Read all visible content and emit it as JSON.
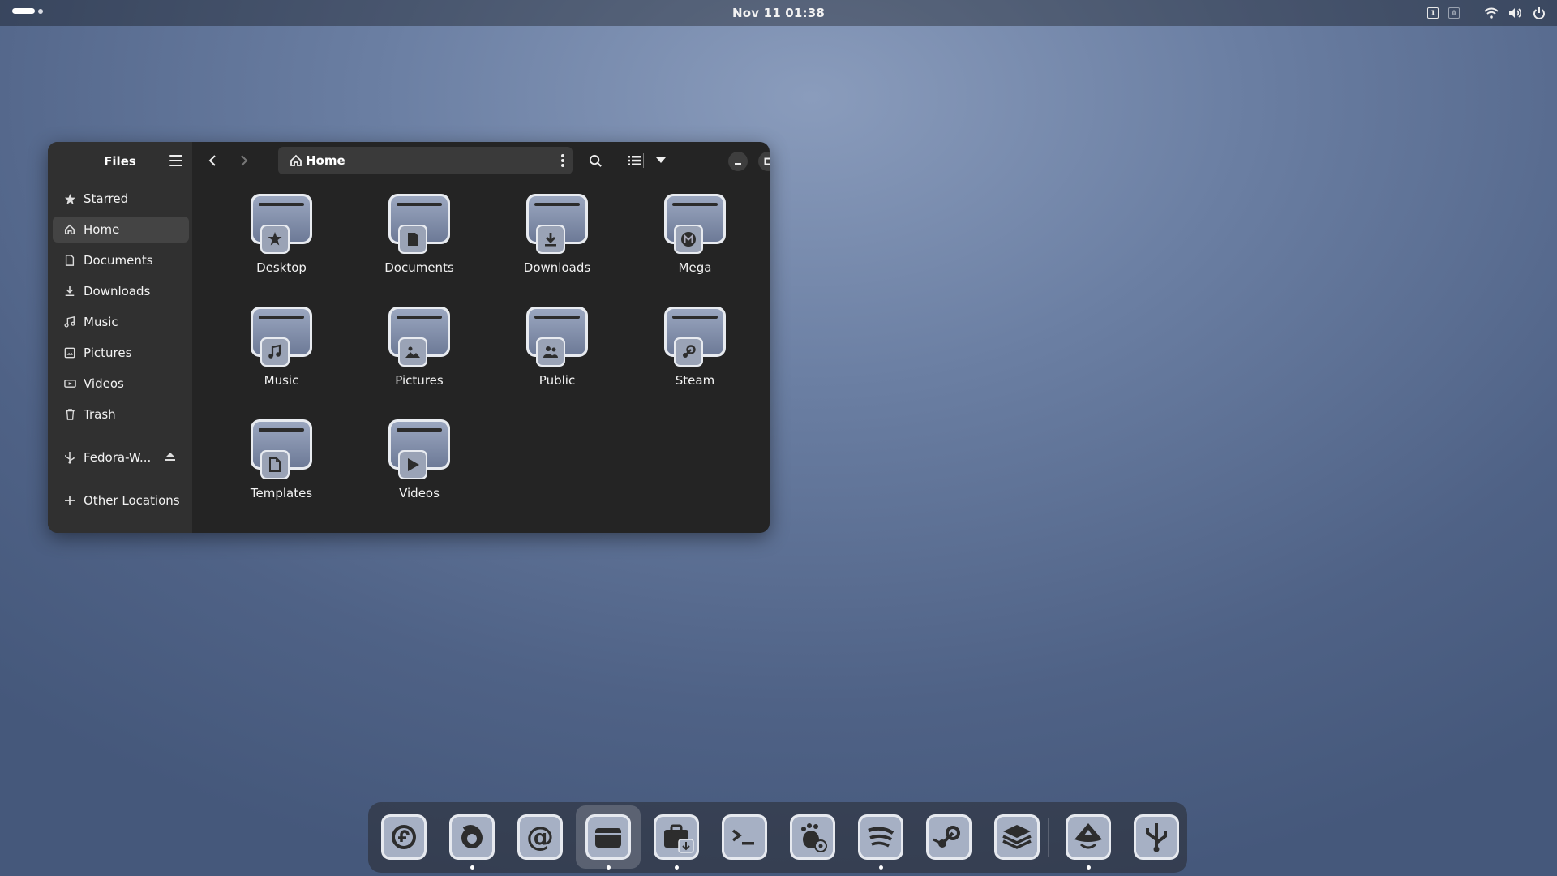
{
  "topbar": {
    "clock": "Nov 11  01:38",
    "indicators": [
      "1",
      "A"
    ]
  },
  "window": {
    "sidebar_title": "Files",
    "location": "Home",
    "places": [
      {
        "label": "Starred",
        "icon": "star-icon"
      },
      {
        "label": "Home",
        "icon": "home-icon",
        "active": true
      },
      {
        "label": "Documents",
        "icon": "document-icon"
      },
      {
        "label": "Downloads",
        "icon": "download-icon"
      },
      {
        "label": "Music",
        "icon": "music-icon"
      },
      {
        "label": "Pictures",
        "icon": "picture-icon"
      },
      {
        "label": "Videos",
        "icon": "video-icon"
      },
      {
        "label": "Trash",
        "icon": "trash-icon"
      }
    ],
    "device": {
      "label": "Fedora-W...",
      "icon": "usb-icon"
    },
    "other_locations": "Other Locations",
    "folders": [
      {
        "label": "Desktop",
        "icon": "star"
      },
      {
        "label": "Documents",
        "icon": "doc"
      },
      {
        "label": "Downloads",
        "icon": "down"
      },
      {
        "label": "Mega",
        "icon": "mega"
      },
      {
        "label": "Music",
        "icon": "music"
      },
      {
        "label": "Pictures",
        "icon": "pics"
      },
      {
        "label": "Public",
        "icon": "people"
      },
      {
        "label": "Steam",
        "icon": "steam"
      },
      {
        "label": "Templates",
        "icon": "tmpl"
      },
      {
        "label": "Videos",
        "icon": "video"
      }
    ]
  },
  "dock": {
    "apps": [
      {
        "name": "fedora-icon",
        "running": false
      },
      {
        "name": "firefox-icon",
        "running": true
      },
      {
        "name": "mail-icon",
        "running": false
      },
      {
        "name": "files-icon",
        "running": true,
        "focused": true
      },
      {
        "name": "software-icon",
        "running": true
      },
      {
        "name": "terminal-icon",
        "running": false
      },
      {
        "name": "gnome-settings-icon",
        "running": false
      },
      {
        "name": "spotify-icon",
        "running": true
      },
      {
        "name": "steam-icon",
        "running": false
      },
      {
        "name": "layers-icon",
        "running": false
      },
      {
        "name": "inkscape-icon",
        "running": true
      },
      {
        "name": "usb-writer-icon",
        "running": false
      }
    ]
  }
}
